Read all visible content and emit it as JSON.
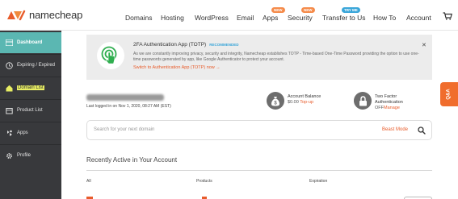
{
  "brand": {
    "name": "namecheap",
    "color": "#e85c2b"
  },
  "nav": {
    "items": [
      {
        "label": "Domains"
      },
      {
        "label": "Hosting"
      },
      {
        "label": "WordPress"
      },
      {
        "label": "Email"
      },
      {
        "label": "Apps",
        "badge": "NEW"
      },
      {
        "label": "Security",
        "badge": "NEW"
      },
      {
        "label": "Transfer to Us",
        "badge": "TRY ME"
      },
      {
        "label": "How To"
      },
      {
        "label": "Account"
      }
    ],
    "cart_icon": "cart-icon"
  },
  "sidebar": {
    "items": [
      {
        "label": "Dashboard",
        "icon": "dashboard-icon",
        "active": true
      },
      {
        "label": "Expiring / Expired",
        "icon": "clock-icon"
      },
      {
        "label": "Domain List",
        "icon": "house-icon",
        "highlight": true
      },
      {
        "label": "Product List",
        "icon": "box-icon"
      },
      {
        "label": "Apps",
        "icon": "apps-icon"
      },
      {
        "label": "Profile",
        "icon": "gear-icon"
      }
    ]
  },
  "twofa": {
    "title": "2FA Authentication App (TOTP)",
    "tag": "RECOMMENDED",
    "text": "As we are constantly improving privacy, security and integrity, Namecheap establishes TOTP - Time-based One-Time Password providing the option to use one-time passwords generated by app, like Google Authenticator to protect your account.",
    "link": "Switch to Authentication App (TOTP) now →",
    "close": "✕"
  },
  "user": {
    "last_login": "Last logged in on Nov 1, 2020, 08:27 AM (EST)"
  },
  "account_balance": {
    "title": "Account Balance",
    "amount": "$0.00",
    "action": "Top-up"
  },
  "two_factor": {
    "title_line1": "Two Factor",
    "title_line2": "Authentication",
    "status": "OFF",
    "action": "Manage"
  },
  "search": {
    "placeholder": "Search for your next domain",
    "beast_mode": "Beast Mode"
  },
  "recent": {
    "title": "Recently Active in Your Account",
    "columns": [
      "All",
      "Products",
      "Expiration"
    ]
  },
  "feedback_tab": {
    "label": "Q&A"
  },
  "colors": {
    "accent": "#5bb7b2",
    "sidebar": "#38393c",
    "orange": "#e85c2b",
    "green": "#2fae4f"
  }
}
